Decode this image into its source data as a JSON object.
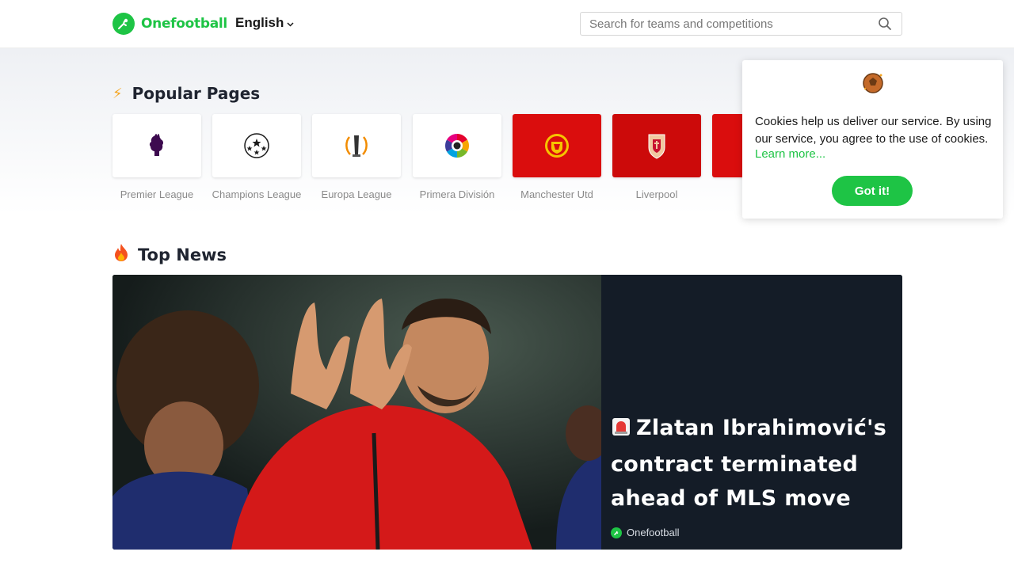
{
  "header": {
    "brand_name": "Onefootball",
    "language": "English",
    "search_placeholder": "Search for teams and competitions"
  },
  "popular": {
    "title": "Popular Pages",
    "items": [
      {
        "label": "Premier League"
      },
      {
        "label": "Champions League"
      },
      {
        "label": "Europa League"
      },
      {
        "label": "Primera División"
      },
      {
        "label": "Manchester Utd"
      },
      {
        "label": "Liverpool"
      }
    ]
  },
  "news": {
    "title": "Top News",
    "headline": "Zlatan Ibrahimović's contract terminated ahead of MLS move",
    "source": "Onefootball"
  },
  "cookie": {
    "text": "Cookies help us deliver our service. By using our service, you agree to the use of cookies.",
    "link": "Learn more...",
    "button": "Got it!"
  },
  "colors": {
    "brand": "#1ec445",
    "card_dark": "#141c27",
    "club_red": "#da0d0d"
  }
}
